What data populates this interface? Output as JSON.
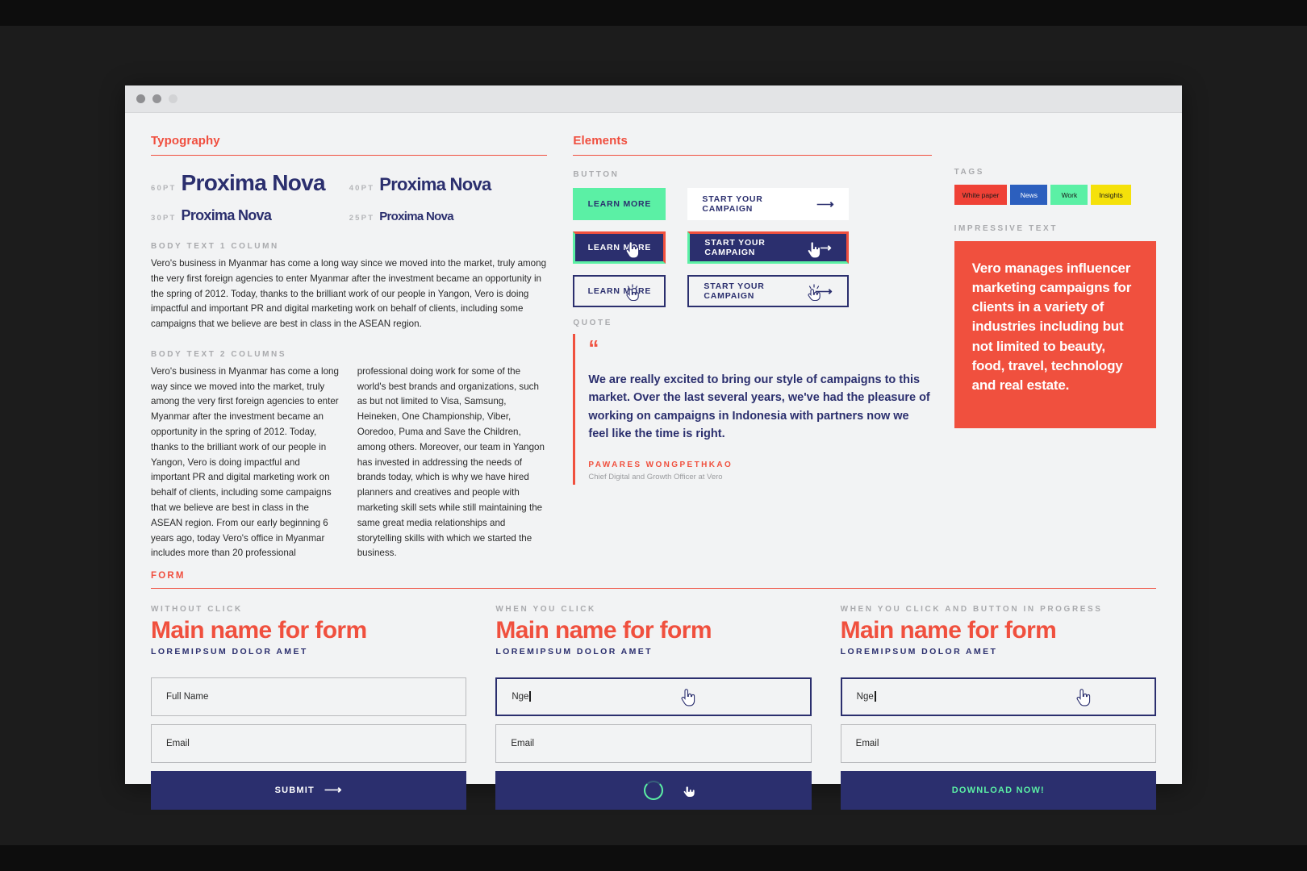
{
  "window": {
    "dots": [
      "close",
      "minimize",
      "maximize"
    ]
  },
  "typography": {
    "heading": "Typography",
    "samples": [
      {
        "pt": "60PT",
        "name": "Proxima Nova"
      },
      {
        "pt": "40PT",
        "name": "Proxima Nova"
      },
      {
        "pt": "30PT",
        "name": "Proxima Nova"
      },
      {
        "pt": "25PT",
        "name": "Proxima Nova"
      }
    ],
    "body1_label": "BODY TEXT 1 COLUMN",
    "body1_text": "Vero's business in Myanmar has come a long way since we moved into the market, truly among the very first foreign agencies to enter Myanmar after the investment became an opportunity in the spring of 2012. Today, thanks to the brilliant work of our people in Yangon, Vero is doing impactful and important PR and digital marketing work on behalf of clients, including some campaigns that we believe are best in class in the ASEAN region.",
    "body2_label": "BODY TEXT 2 COLUMNS",
    "body2_col1": "Vero's business in Myanmar has come a long way since we moved into the market, truly among the very first foreign agencies to enter Myanmar after the investment became an opportunity in the spring of 2012. Today, thanks to the brilliant work of our people in Yangon, Vero is doing impactful and important PR and digital marketing work on behalf of clients, including some campaigns that we believe are best in class in the ASEAN region. From our early beginning 6 years ago, today Vero's office in Myanmar includes more than 20 professional",
    "body2_col2": "professional doing work for some of the world's best brands and organizations, such as but not limited to Visa, Samsung, Heineken, One Championship, Viber, Ooredoo, Puma and Save the Children, among others. Moreover, our team in Yangon has invested in addressing the needs of brands today, which is why we have hired planners and creatives and people with marketing skill sets while still maintaining the same great media relationships and storytelling skills with which we started the business."
  },
  "elements": {
    "heading": "Elements",
    "button_label": "BUTTON",
    "buttons": {
      "learn_more": "LEARN MORE",
      "start_campaign": "START YOUR CAMPAIGN",
      "arrow": "⟶"
    },
    "quote_label": "QUOTE",
    "quote_mark": "“",
    "quote_text": "We are really excited to bring our style of campaigns to this market. Over the last several years, we've had the pleasure of working on campaigns in Indonesia with partners now we feel like the time is right.",
    "quote_author": "PAWARES WONGPETHKAO",
    "quote_role": "Chief Digital and Growth Officer at Vero"
  },
  "tags": {
    "label": "TAGS",
    "items": [
      {
        "text": "White paper",
        "color": "#ef4136"
      },
      {
        "text": "News",
        "color": "#2c5fbe"
      },
      {
        "text": "Work",
        "color": "#5bf0a5"
      },
      {
        "text": "Insights",
        "color": "#f5e10a"
      }
    ]
  },
  "impressive": {
    "label": "IMPRESSIVE TEXT",
    "text": "Vero manages influencer marketing campaigns for clients in a variety of industries including but not limited to beauty, food, travel, technology and real estate.",
    "bg": "#f0503e"
  },
  "form": {
    "heading": "FORM",
    "columns": [
      {
        "state_label": "WITHOUT CLICK",
        "main": "Main name for form",
        "sub": "LOREMIPSUM DOLOR AMET",
        "name_value": "Full Name",
        "email_value": "Email",
        "button_label": "SUBMIT",
        "button_arrow": "⟶"
      },
      {
        "state_label": "WHEN YOU CLICK",
        "main": "Main name for form",
        "sub": "LOREMIPSUM DOLOR AMET",
        "name_value": "Nge",
        "email_value": "Email",
        "button_label": ""
      },
      {
        "state_label": "WHEN YOU CLICK AND BUTTON IN PROGRESS",
        "main": "Main name for form",
        "sub": "LOREMIPSUM DOLOR AMET",
        "name_value": "Nge",
        "email_value": "Email",
        "button_label": "DOWNLOAD NOW!"
      }
    ]
  },
  "colors": {
    "navy": "#2b2f6e",
    "red": "#f0503e",
    "green": "#5bf0a5",
    "page_bg": "#f2f3f4"
  }
}
